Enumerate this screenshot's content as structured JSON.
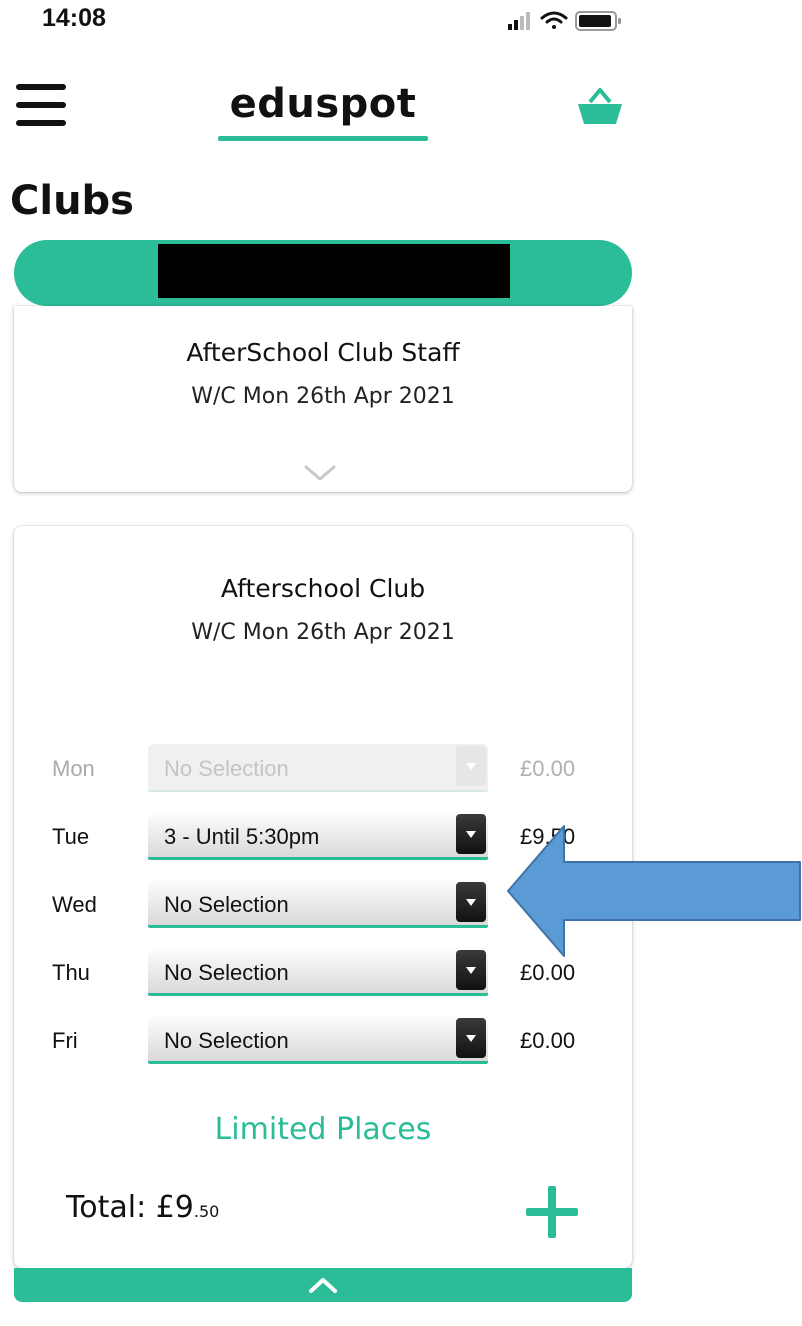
{
  "status_bar": {
    "time": "14:08"
  },
  "header": {
    "logo": "eduspot"
  },
  "page": {
    "title": "Clubs"
  },
  "colors": {
    "accent": "#2bbd98",
    "arrow": "#5b9bd5",
    "arrow_border": "#3f73a8"
  },
  "icons": [
    "menu-icon",
    "basket-icon",
    "chevron-down-icon",
    "select-arrow-icon",
    "plus-icon",
    "chevron-up-icon",
    "signal-icon",
    "wifi-icon",
    "battery-icon"
  ],
  "clubs": [
    {
      "title": "AfterSchool Club Staff",
      "week": "W/C Mon 26th Apr 2021"
    },
    {
      "title": "Afterschool Club",
      "week": "W/C Mon 26th Apr 2021",
      "days": [
        {
          "day": "Mon",
          "selection": "No Selection",
          "price": "£0.00",
          "enabled": false
        },
        {
          "day": "Tue",
          "selection": "3 - Until 5:30pm",
          "price": "£9.50",
          "enabled": true
        },
        {
          "day": "Wed",
          "selection": "No Selection",
          "price": "",
          "enabled": true
        },
        {
          "day": "Thu",
          "selection": "No Selection",
          "price": "£0.00",
          "enabled": true
        },
        {
          "day": "Fri",
          "selection": "No Selection",
          "price": "£0.00",
          "enabled": true
        }
      ],
      "availability": "Limited Places",
      "total_label": "Total: £9",
      "total_pence": ".50"
    }
  ]
}
